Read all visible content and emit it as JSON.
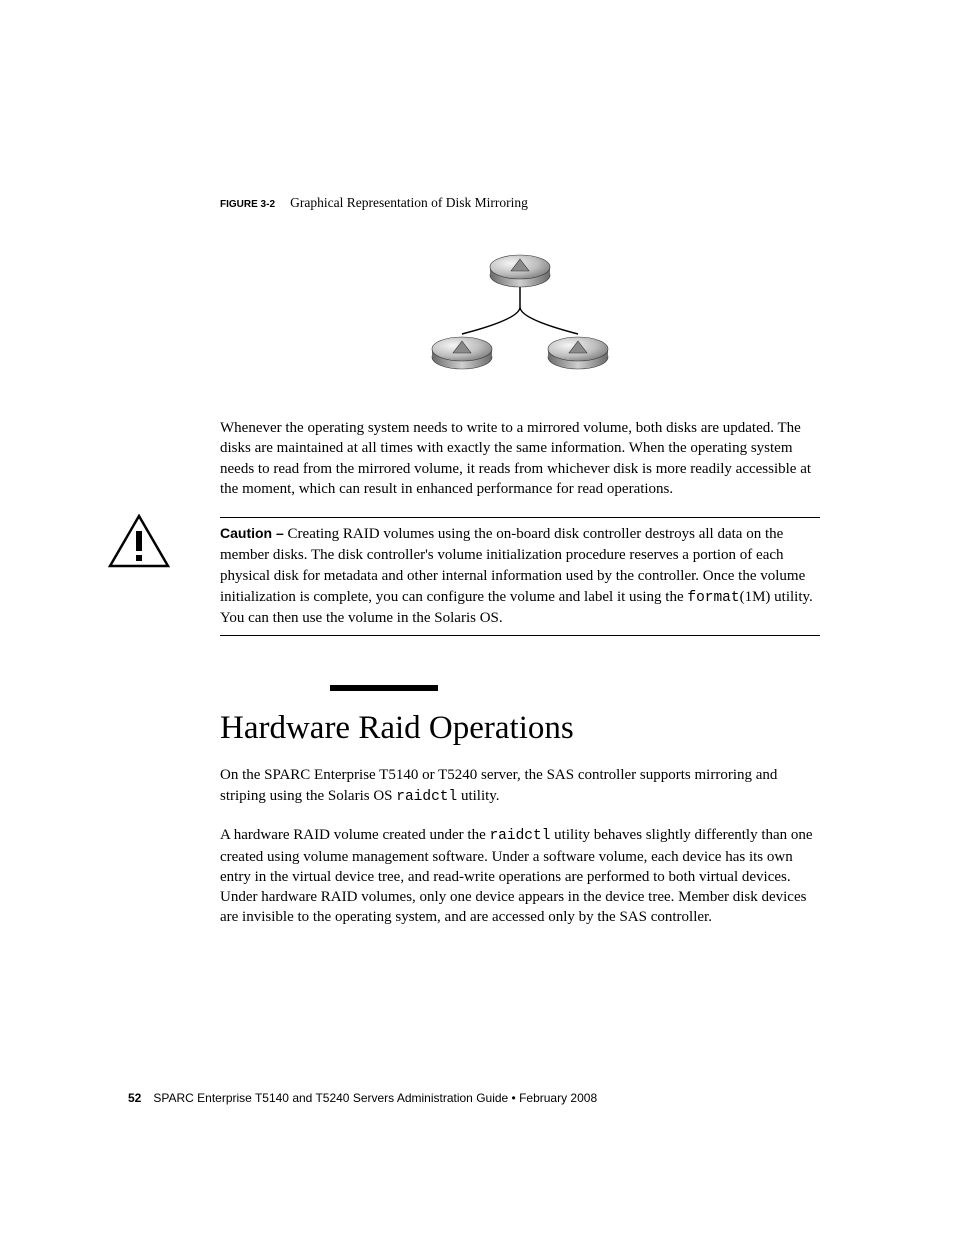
{
  "figure": {
    "label": "FIGURE 3-2",
    "caption": "Graphical Representation of Disk Mirroring"
  },
  "para1": "Whenever the operating system needs to write to a mirrored volume, both disks are updated. The disks are maintained at all times with exactly the same information. When the operating system needs to read from the mirrored volume, it reads from whichever disk is more readily accessible at the moment, which can result in enhanced performance for read operations.",
  "caution": {
    "label": "Caution –",
    "text_before": " Creating RAID volumes using the on-board disk controller destroys all data on the member disks. The disk controller's volume initialization procedure reserves a portion of each physical disk for metadata and other internal information used by the controller. Once the volume initialization is complete, you can configure the volume and label it using the ",
    "mono": "format",
    "text_after": "(1M) utility. You can then use the volume in the Solaris OS."
  },
  "heading": "Hardware Raid Operations",
  "para2_before": "On the SPARC Enterprise T5140 or T5240 server, the SAS controller supports mirroring and striping using the Solaris OS ",
  "para2_mono": "raidctl",
  "para2_after": " utility.",
  "para3_before": "A hardware RAID volume created under the ",
  "para3_mono": "raidctl",
  "para3_after": " utility behaves slightly differently than one created using volume management software. Under a software volume, each device has its own entry in the virtual device tree, and read-write operations are performed to both virtual devices. Under hardware RAID volumes, only one device appears in the device tree. Member disk devices are invisible to the operating system, and are accessed only by the SAS controller.",
  "footer": {
    "pagenum": "52",
    "text": "SPARC Enterprise T5140 and T5240 Servers Administration Guide • February 2008"
  }
}
